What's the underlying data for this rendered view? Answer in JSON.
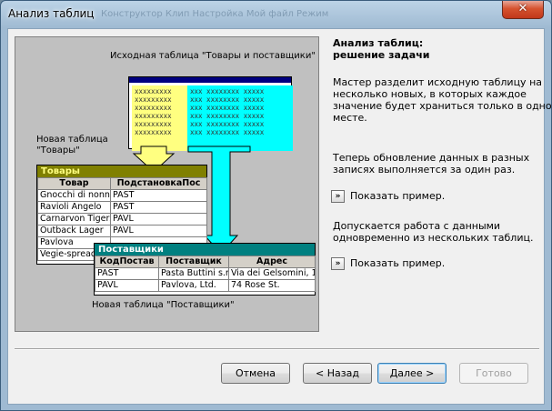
{
  "window": {
    "title": "Анализ таблиц",
    "close_glyph": "✕",
    "background_title_text": "Конструктор  Клип  Настройка  Мой файл  Режим"
  },
  "diagram": {
    "source_label": "Исходная таблица \"Товары и поставщики\"",
    "source_yellow_text": "xxxxxxxxx\nxxxxxxxxx\nxxxxxxxxx\nxxxxxxxxx\nxxxxxxxxx\nxxxxxxxxx",
    "source_cyan_text": "xxx xxxxxxxx xxxxx\nxxx xxxxxxxx xxxxx\nxxx xxxxxxxx xxxxx\nxxx xxxxxxxx xxxxx\nxxx xxxxxxxx xxxxx\nxxx xxxxxxxx xxxxx",
    "new_table1_label": "Новая таблица\n\"Товары\"",
    "table1": {
      "caption": "Товары",
      "columns": [
        "Товар",
        "ПодстановкаПос"
      ],
      "rows": [
        [
          "Gnocchi di nonna",
          "PAST"
        ],
        [
          "Ravioli Angelo",
          "PAST"
        ],
        [
          "Carnarvon Tigers",
          "PAVL"
        ],
        [
          "Outback Lager",
          "PAVL"
        ],
        [
          "Pavlova",
          ""
        ],
        [
          "Vegie-spread",
          ""
        ]
      ]
    },
    "table2": {
      "caption": "Поставщики",
      "columns": [
        "КодПостав",
        "Поставщик",
        "Адрес"
      ],
      "rows": [
        [
          "PAST",
          "Pasta Buttini s.r",
          "Via dei Gelsomini, 1"
        ],
        [
          "PAVL",
          "Pavlova, Ltd.",
          "74 Rose St."
        ]
      ]
    },
    "new_table2_label": "Новая таблица \"Поставщики\""
  },
  "info": {
    "heading": "Анализ таблиц:\nрешение задачи",
    "paragraph1": "Мастер разделит исходную таблицу на\nнесколько новых, в которых каждое\nзначение будет храниться только в одном\nместе.",
    "paragraph2": "Теперь обновление данных в разных\nзаписях выполняется за один раз.",
    "example1_button": "»",
    "example1_label": "Показать пример.",
    "paragraph3": "Допускается работа с данными\nодновременно из нескольких таблиц.",
    "example2_button": "»",
    "example2_label": "Показать пример."
  },
  "buttons": {
    "cancel": "Отмена",
    "back": "< Назад",
    "next": "Далее >",
    "finish": "Готово"
  }
}
